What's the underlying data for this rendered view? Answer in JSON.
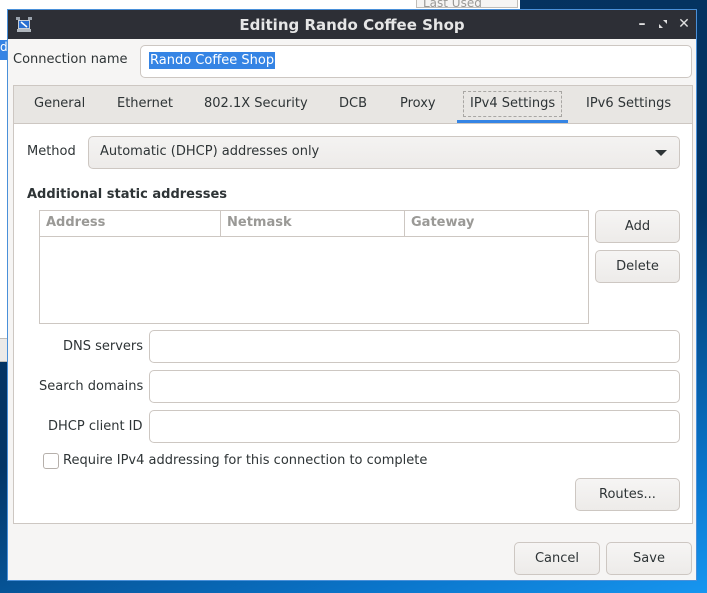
{
  "background": {
    "column_header": "Last Used",
    "column_header_icon": "sort-down-icon"
  },
  "dialog": {
    "title": "Editing Rando Coffee Shop",
    "app_icon": "network-computer-icon",
    "window_buttons": {
      "minimize": "–",
      "maximize": "⤡",
      "close": "✕"
    },
    "connection_name_label": "Connection name",
    "connection_name_value": "Rando Coffee Shop",
    "tabs": [
      {
        "label": "General",
        "active": false
      },
      {
        "label": "Ethernet",
        "active": false
      },
      {
        "label": "802.1X Security",
        "active": false
      },
      {
        "label": "DCB",
        "active": false
      },
      {
        "label": "Proxy",
        "active": false
      },
      {
        "label": "IPv4 Settings",
        "active": true
      },
      {
        "label": "IPv6 Settings",
        "active": false
      }
    ],
    "ipv4": {
      "method_label": "Method",
      "method_value": "Automatic (DHCP) addresses only",
      "static_section_title": "Additional static addresses",
      "table_columns": [
        "Address",
        "Netmask",
        "Gateway"
      ],
      "table_rows": [],
      "add_button": "Add",
      "delete_button": "Delete",
      "dns_label": "DNS servers",
      "dns_value": "",
      "search_domains_label": "Search domains",
      "search_domains_value": "",
      "dhcp_client_id_label": "DHCP client ID",
      "dhcp_client_id_value": "",
      "require_ipv4_label": "Require IPv4 addressing for this connection to complete",
      "require_ipv4_checked": false,
      "routes_button": "Routes..."
    },
    "cancel_button": "Cancel",
    "save_button": "Save"
  },
  "colors": {
    "accent": "#3584e4",
    "titlebar": "#2d2f36",
    "dialog_bg": "#f6f5f4",
    "border": "#cdc7c2"
  }
}
